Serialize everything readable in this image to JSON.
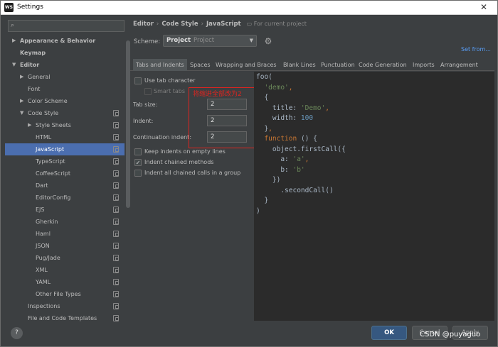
{
  "window": {
    "title": "Settings",
    "app_icon": "WS",
    "close": "✕"
  },
  "sidebar": {
    "search": {
      "icon": "search-icon",
      "value": ""
    },
    "items": [
      {
        "label": "Appearance & Behavior",
        "arrow": "▶",
        "level": 0,
        "bold": true
      },
      {
        "label": "Keymap",
        "arrow": "",
        "level": 0,
        "bold": true
      },
      {
        "label": "Editor",
        "arrow": "▼",
        "level": 0,
        "bold": true
      },
      {
        "label": "General",
        "arrow": "▶",
        "level": 1
      },
      {
        "label": "Font",
        "arrow": "",
        "level": 1
      },
      {
        "label": "Color Scheme",
        "arrow": "▶",
        "level": 1
      },
      {
        "label": "Code Style",
        "arrow": "▼",
        "level": 1,
        "copy": true
      },
      {
        "label": "Style Sheets",
        "arrow": "▶",
        "level": 2,
        "copy": true
      },
      {
        "label": "HTML",
        "arrow": "",
        "level": 2,
        "copy": true
      },
      {
        "label": "JavaScript",
        "arrow": "",
        "level": 2,
        "copy": true,
        "selected": true
      },
      {
        "label": "TypeScript",
        "arrow": "",
        "level": 2,
        "copy": true
      },
      {
        "label": "CoffeeScript",
        "arrow": "",
        "level": 2,
        "copy": true
      },
      {
        "label": "Dart",
        "arrow": "",
        "level": 2,
        "copy": true
      },
      {
        "label": "EditorConfig",
        "arrow": "",
        "level": 2,
        "copy": true
      },
      {
        "label": "EJS",
        "arrow": "",
        "level": 2,
        "copy": true
      },
      {
        "label": "Gherkin",
        "arrow": "",
        "level": 2,
        "copy": true
      },
      {
        "label": "Haml",
        "arrow": "",
        "level": 2,
        "copy": true
      },
      {
        "label": "JSON",
        "arrow": "",
        "level": 2,
        "copy": true
      },
      {
        "label": "Pug/Jade",
        "arrow": "",
        "level": 2,
        "copy": true
      },
      {
        "label": "XML",
        "arrow": "",
        "level": 2,
        "copy": true
      },
      {
        "label": "YAML",
        "arrow": "",
        "level": 2,
        "copy": true
      },
      {
        "label": "Other File Types",
        "arrow": "",
        "level": 2,
        "copy": true
      },
      {
        "label": "Inspections",
        "arrow": "",
        "level": 1,
        "copy": true
      },
      {
        "label": "File and Code Templates",
        "arrow": "",
        "level": 1,
        "copy": true
      }
    ]
  },
  "breadcrumb": {
    "items": [
      "Editor",
      "Code Style",
      "JavaScript"
    ],
    "separator": "›",
    "hint": "For current project",
    "hint_icon": "project-icon"
  },
  "scheme": {
    "label": "Scheme:",
    "name": "Project",
    "kind": "Project",
    "arrow": "▼",
    "gear_icon": "gear-icon",
    "set_from": "Set from..."
  },
  "tabs": [
    "Tabs and Indents",
    "Spaces",
    "Wrapping and Braces",
    "Blank Lines",
    "Punctuation",
    "Code Generation",
    "Imports",
    "Arrangement"
  ],
  "active_tab": "Tabs and Indents",
  "options": {
    "use_tab_character": {
      "label": "Use tab character",
      "checked": false
    },
    "smart_tabs": {
      "label": "Smart tabs",
      "checked": false,
      "enabled": false
    },
    "tab_size": {
      "label": "Tab size:",
      "value": "2"
    },
    "indent": {
      "label": "Indent:",
      "value": "2"
    },
    "continuation_indent": {
      "label": "Continuation indent:",
      "value": "2"
    },
    "keep_indents_empty": {
      "label": "Keep indents on empty lines",
      "checked": false
    },
    "indent_chained": {
      "label": "Indent chained methods",
      "checked": true
    },
    "indent_all_chained": {
      "label": "Indent all chained calls in a group",
      "checked": false
    }
  },
  "annotation": {
    "text": "将缩进全部改为2",
    "color": "#e0241f"
  },
  "code_preview": [
    "foo(",
    "  'demo',",
    "  {",
    "    title: 'Demo',",
    "    width: 100",
    "  },",
    "  function () {",
    "    object.firstCall({",
    "      a: 'a',",
    "      b: 'b'",
    "    })",
    "      .secondCall()",
    "  }",
    ")"
  ],
  "footer": {
    "help": "?",
    "ok": "OK",
    "cancel": "Cancel",
    "apply": "Apply"
  },
  "watermark": "CSDN @puyaguo",
  "colors": {
    "selection": "#4b6eaf",
    "ok_button": "#365880",
    "link": "#589df6",
    "editor_bg": "#2b2b2b",
    "string": "#6a8759",
    "keyword": "#cc7832",
    "number": "#6897bb"
  }
}
